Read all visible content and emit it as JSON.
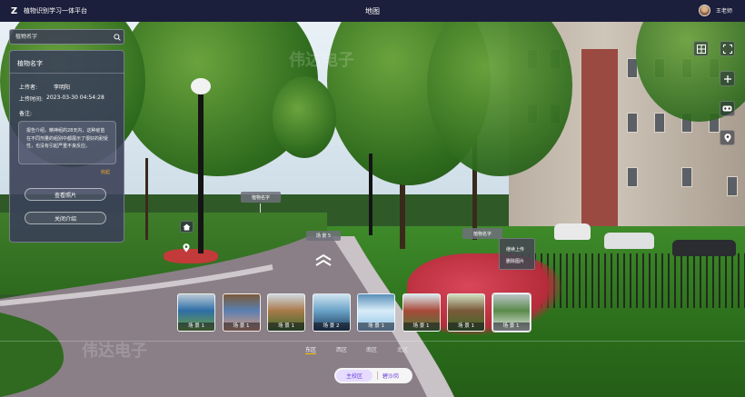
{
  "app": {
    "title": "植物识别学习一体平台",
    "page_title": "地图",
    "user_name": "王老师"
  },
  "search": {
    "placeholder": "植物名字"
  },
  "info_panel": {
    "title": "植物名字",
    "uploader_label": "上传者:",
    "uploader": "李明阳",
    "upload_time_label": "上传时间:",
    "upload_time": "2023-03-30 04:54:28",
    "remark_label": "备注:",
    "remark_lines": [
      "报告介绍，精神组的28天内，这种疫苗",
      "在不同剂量的组别中都展示了很好的耐受",
      "性，也没有引起严重不良反应。"
    ],
    "collapse_label": "收起",
    "view_photo_label": "查看照片",
    "close_intro_label": "关闭介绍"
  },
  "hotspots": {
    "tag_left": "植物名字",
    "tag_right": "植物名字",
    "scene_label": "场 景 5",
    "context_menu": [
      "继续上传",
      "删除图片"
    ]
  },
  "scenes": [
    {
      "label": "场 景 1",
      "palette": [
        "#6da040",
        "#2e6ea6",
        "#b9c9d6"
      ]
    },
    {
      "label": "场 景 1",
      "palette": [
        "#d99a7c",
        "#5a7fb2",
        "#7a5a3a"
      ]
    },
    {
      "label": "场 景 1",
      "palette": [
        "#3a6a2a",
        "#a97a4a",
        "#cfd8e0"
      ]
    },
    {
      "label": "场 景 2",
      "palette": [
        "#1d3a5a",
        "#6aa3c8",
        "#cfe3f0"
      ]
    },
    {
      "label": "场 景 1",
      "palette": [
        "#8fc2e8",
        "#d8ecf8",
        "#5a8fb8"
      ]
    },
    {
      "label": "场 景 1",
      "palette": [
        "#4a7a3a",
        "#a84a3a",
        "#d9e6ee"
      ]
    },
    {
      "label": "场 景 1",
      "palette": [
        "#3f6a2a",
        "#7a5a3a",
        "#cfe0c0"
      ]
    },
    {
      "label": "场 景 1",
      "palette": [
        "#e8ecea",
        "#5a8a4a",
        "#bcc4c8"
      ]
    }
  ],
  "active_scene_index": 7,
  "areas": [
    "东区",
    "西区",
    "南区",
    "北区"
  ],
  "active_area_index": 0,
  "campuses": [
    "主校区",
    "碧沙岗"
  ],
  "active_campus_index": 0,
  "watermark": "伟达电子",
  "colors": {
    "topbar": "#1c1f3b",
    "accent_orange": "#f4a62a",
    "campus_active_bg": "#e6dcff",
    "campus_text": "#6a3fd8",
    "area_underline": "#f2c200"
  },
  "icons": [
    "search-icon",
    "layout-icon",
    "fullscreen-icon",
    "zoom-in-icon",
    "vr-headset-icon",
    "location-icon",
    "home-upload-icon",
    "pin-icon",
    "chevron-up-icon"
  ]
}
